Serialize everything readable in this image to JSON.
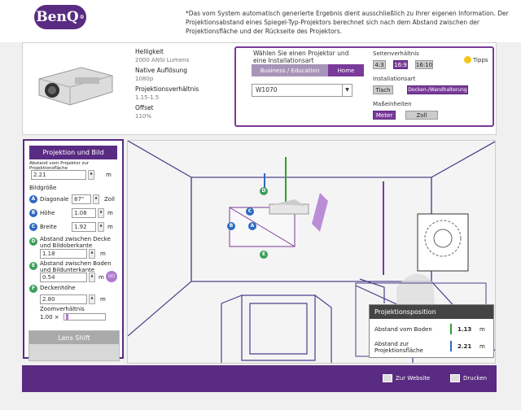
{
  "header": {
    "logo": "BenQ",
    "logo_mark": "®",
    "note": "*Das vom System automatisch generierte Ergebnis dient ausschließlich zu Ihrer eigenen Information. Der Projektionsabstand eines Spiegel-Typ-Projektors berechnet sich nach dem Abstand zwischen der Projektionsfläche und der Rückseite des Projektors."
  },
  "specs": {
    "brightness_label": "Helligkeit",
    "brightness_value": "2000 ANSI Lumens",
    "resolution_label": "Native Auflösung",
    "resolution_value": "1080p",
    "ratio_label": "Projektionsverhältnis",
    "ratio_value": "1.15-1.5",
    "offset_label": "Offset",
    "offset_value": "110%"
  },
  "selector": {
    "title": "Wählen Sie einen Projektor und eine Installationsart",
    "tab_business": "Business / Education",
    "tab_home": "Home",
    "model": "W1070",
    "model_arrow": "▼",
    "aspect_label": "Seitenverhältnis",
    "aspect_options": [
      "4:3",
      "16:9",
      "16:10"
    ],
    "install_label": "Installationsart",
    "install_options": [
      "Tisch",
      "Decken-/Wandhalterung"
    ],
    "units_label": "Maßeinheiten",
    "unit_options": [
      "Meter",
      "Zoll"
    ],
    "tips": "Tipps"
  },
  "left": {
    "title": "Projektion und Bild",
    "distance_label": "Abstand vom Projektor zur Projektionsfläche",
    "distance_value": "2.21",
    "distance_unit": "m",
    "size_label": "Bildgröße",
    "diag_letter": "A",
    "diag_label": "Diagonale",
    "diag_value": "87\"",
    "diag_unit": "Zoll",
    "height_letter": "B",
    "height_label": "Höhe",
    "height_value": "1.08",
    "height_unit": "m",
    "width_letter": "C",
    "width_label": "Breite",
    "width_value": "1.92",
    "width_unit": "m",
    "d_letter": "D",
    "d_label": "Abstand zwischen Decke und Bildoberkante",
    "d_value": "1.18",
    "d_unit": "m",
    "e_letter": "E",
    "e_label": "Abstand zwischen Boden und Bildunterkante",
    "e_value": "0.54",
    "e_unit": "m",
    "go": "GO",
    "f_letter": "F",
    "f_label": "Deckenhöhe",
    "f_value": "2.80",
    "f_unit": "m",
    "zoom_label": "Zoomverhältnis",
    "zoom_value": "1.00 ×",
    "spin_up": "▲",
    "spin_down": "▼"
  },
  "lens": {
    "title": "Lens Shift"
  },
  "position": {
    "title": "Projektionsposition",
    "floor_label": "Abstand vom Boden",
    "floor_value": "1.13",
    "floor_unit": "m",
    "screen_label": "Abstand zur Projektionsfläche",
    "screen_value": "2.21",
    "screen_unit": "m"
  },
  "footer": {
    "website": "Zur Website",
    "print": "Drucken"
  },
  "colors": {
    "brand": "#5a2b82",
    "accent": "#7a3a99",
    "green": "#2ca02c",
    "blue": "#2a6ac0"
  }
}
